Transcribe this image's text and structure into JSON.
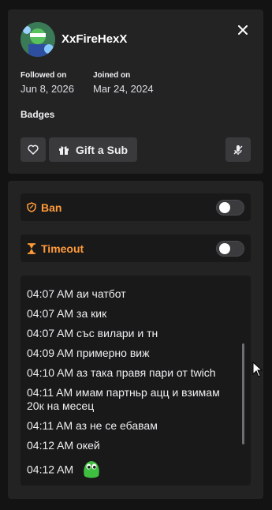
{
  "user": {
    "name": "XxFireHexX",
    "followed_label": "Followed on",
    "followed_value": "Jun 8, 2026",
    "joined_label": "Joined on",
    "joined_value": "Mar 24, 2024"
  },
  "badges_label": "Badges",
  "actions": {
    "gift_label": "Gift a Sub"
  },
  "moderation": {
    "ban_label": "Ban",
    "timeout_label": "Timeout"
  },
  "messages": [
    {
      "time": "04:07 AM",
      "text": "аи чатбот"
    },
    {
      "time": "04:07 AM",
      "text": "за кик"
    },
    {
      "time": "04:07 AM",
      "text": "със вилари и тн"
    },
    {
      "time": "04:09 AM",
      "text": "примерно виж"
    },
    {
      "time": "04:10 AM",
      "text": "аз така правя пари от twich"
    },
    {
      "time": "04:11 AM",
      "text": "имам партньр ацц и взимам 20к на месец"
    },
    {
      "time": "04:11 AM",
      "text": "аз не се ебавам"
    },
    {
      "time": "04:12 AM",
      "text": "окей"
    },
    {
      "time": "04:12 AM",
      "text": ""
    }
  ],
  "colors": {
    "accent_orange": "#ff9b39",
    "emote_green": "#3fbf3f",
    "panel_bg": "#232324",
    "row_bg": "#19191a"
  },
  "icons": [
    "close-icon",
    "heart-icon",
    "gift-icon",
    "mic-off-icon",
    "shield-icon",
    "hourglass-icon",
    "cursor-icon",
    "emote-icon"
  ]
}
